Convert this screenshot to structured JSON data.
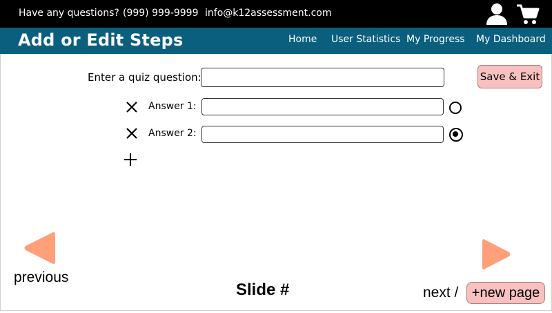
{
  "contact": {
    "questions": "Have any questions?",
    "phone": "(999) 999-9999",
    "email": "info@k12assessment.com"
  },
  "header_icons": [
    "user-icon",
    "cart-icon"
  ],
  "title": "Add or Edit Steps",
  "nav": {
    "home": "Home",
    "user_statistics": "User Statistics",
    "my_progress": "My Progress",
    "my_dashboard": "My Dashboard"
  },
  "quiz": {
    "question_label": "Enter a quiz question:",
    "question_value": "",
    "answers": [
      {
        "label": "Answer 1:",
        "value": "",
        "selected": false
      },
      {
        "label": "Answer 2:",
        "value": "",
        "selected": true
      }
    ]
  },
  "buttons": {
    "save_exit": "Save & Exit",
    "new_page": "+new page"
  },
  "footer": {
    "previous": "previous",
    "slide": "Slide #",
    "next": "next /"
  },
  "colors": {
    "topbar": "#000000",
    "titlebar": "#0a5f7e",
    "arrow": "#ffa07a",
    "button_bg": "#f9c0c0"
  }
}
